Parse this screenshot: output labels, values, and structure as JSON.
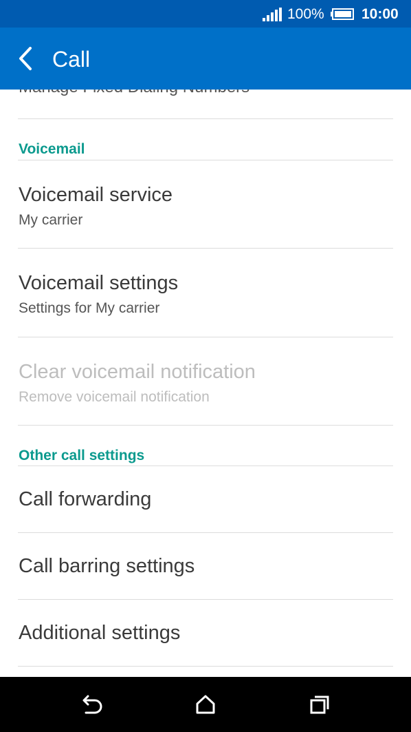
{
  "status_bar": {
    "battery_text": "100%",
    "time": "10:00",
    "icons": [
      "signal-icon",
      "battery-icon"
    ]
  },
  "app_bar": {
    "title": "Call",
    "back_icon": "back-arrow-icon",
    "background": "#0070c8"
  },
  "content": {
    "partial_item": "Manage Fixed Dialing Numbers",
    "sections": [
      {
        "header": "Voicemail",
        "items": [
          {
            "title": "Voicemail service",
            "subtitle": "My carrier",
            "enabled": true
          },
          {
            "title": "Voicemail settings",
            "subtitle": "Settings for My carrier",
            "enabled": true
          },
          {
            "title": "Clear voicemail notification",
            "subtitle": "Remove voicemail notification",
            "enabled": false
          }
        ]
      },
      {
        "header": "Other call settings",
        "items": [
          {
            "title": "Call forwarding",
            "enabled": true
          },
          {
            "title": "Call barring settings",
            "enabled": true
          },
          {
            "title": "Additional settings",
            "enabled": true
          }
        ]
      }
    ],
    "accent_color": "#0b9a8e"
  },
  "nav_bar": {
    "buttons": [
      "back-icon",
      "home-icon",
      "recents-icon"
    ]
  }
}
